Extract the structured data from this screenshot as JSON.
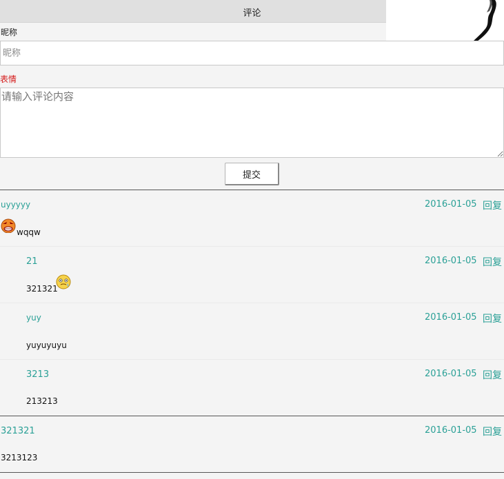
{
  "header": {
    "title": "评论"
  },
  "form": {
    "nickname_label": "昵称",
    "nickname_placeholder": "昵称",
    "emoji_label": "表情",
    "content_placeholder": "请输入评论内容",
    "submit_label": "提交"
  },
  "comments": [
    {
      "name": "uyyyyy",
      "date": "2016-01-05",
      "reply": "回复",
      "text": "wqqw",
      "emoji": "angry-face-icon",
      "replies": [
        {
          "name": "21",
          "date": "2016-01-05",
          "reply": "回复",
          "text": "321321",
          "emoji": "sweat-face-icon"
        },
        {
          "name": "yuy",
          "date": "2016-01-05",
          "reply": "回复",
          "text": "yuyuyuyu"
        },
        {
          "name": "3213",
          "date": "2016-01-05",
          "reply": "回复",
          "text": "213213"
        }
      ]
    },
    {
      "name": "321321",
      "date": "2016-01-05",
      "reply": "回复",
      "text": "3213123",
      "replies": []
    }
  ]
}
